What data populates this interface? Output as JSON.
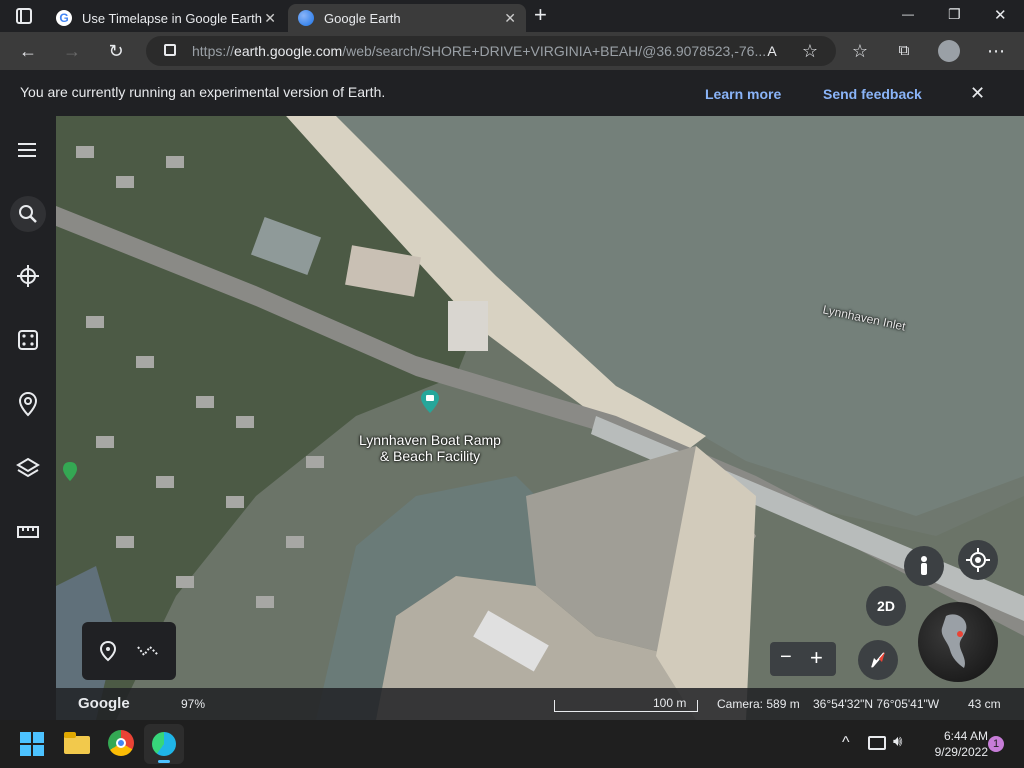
{
  "tabs": [
    {
      "title": "Use Timelapse in Google Earth -",
      "close": "✕"
    },
    {
      "title": "Google Earth",
      "close": "✕"
    }
  ],
  "window": {
    "minimize": "—",
    "restore": "❐",
    "close": "✕",
    "new_tab": "+"
  },
  "address": {
    "prefix": "https://",
    "host": "earth.google.com",
    "path": "/web/search/SHORE+DRIVE+VIRGINIA+BEAH/@36.9078523,-76..."
  },
  "banner": {
    "message": "You are currently running an experimental version of Earth.",
    "learn_more": "Learn more",
    "send_feedback": "Send feedback",
    "close": "✕"
  },
  "map": {
    "place_label_line1": "Lynnhaven Boat Ramp",
    "place_label_line2": "& Beach Facility",
    "water_label": "Lynnhaven Inlet",
    "btn_2d": "2D",
    "zoom_out": "−",
    "zoom_in": "+"
  },
  "status": {
    "logo": "Google",
    "load": "97%",
    "scale": "100 m",
    "camera": "Camera: 589 m",
    "coords": "36°54'32\"N 76°05'41\"W",
    "size": "43 cm"
  },
  "taskbar": {
    "time": "6:44 AM",
    "date": "9/29/2022",
    "notifications": "1",
    "chevron": "^"
  }
}
